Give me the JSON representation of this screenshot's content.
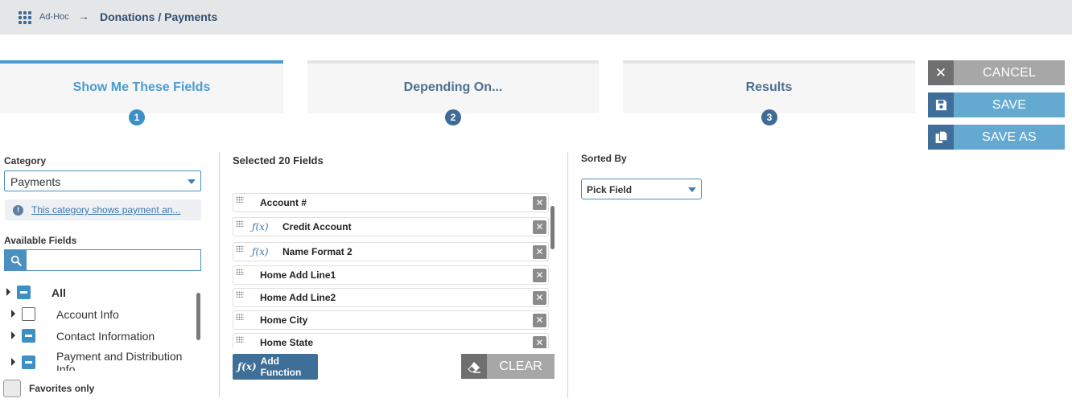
{
  "breadcrumb": {
    "root": "Ad-Hoc",
    "arrow": "→",
    "title": "Donations / Payments"
  },
  "steps": [
    {
      "label": "Show Me These Fields",
      "number": "1",
      "active": true
    },
    {
      "label": "Depending On...",
      "number": "2",
      "active": false
    },
    {
      "label": "Results",
      "number": "3",
      "active": false
    }
  ],
  "actions": {
    "cancel": "CANCEL",
    "save": "SAVE",
    "save_as": "SAVE AS"
  },
  "left": {
    "category_label": "Category",
    "category_value": "Payments",
    "info_text": "This category shows payment an...",
    "available_label": "Available Fields",
    "search_placeholder": "",
    "tree": [
      {
        "label": "All",
        "state": "partial"
      },
      {
        "label": "Account Info",
        "state": "empty"
      },
      {
        "label": "Contact Information",
        "state": "partial"
      },
      {
        "label": "Payment and Distribution Info",
        "state": "partial"
      }
    ],
    "favorites_label": "Favorites only"
  },
  "middle": {
    "selected_label": "Selected 20 Fields",
    "fields": [
      {
        "name": "Account #",
        "fx": false
      },
      {
        "name": "Credit Account",
        "fx": true
      },
      {
        "name": "Name Format 2",
        "fx": true
      },
      {
        "name": "Home Add Line1",
        "fx": false
      },
      {
        "name": "Home Add Line2",
        "fx": false
      },
      {
        "name": "Home City",
        "fx": false
      },
      {
        "name": "Home State",
        "fx": false
      }
    ],
    "fx_symbol": "ƒ(x)",
    "add_function": "Add Function",
    "clear": "CLEAR"
  },
  "right": {
    "sorted_label": "Sorted By",
    "sort_value": "Pick Field"
  },
  "colors": {
    "accent": "#4b9bd0",
    "dark_blue": "#3f6e99",
    "light_blue": "#63a9d0",
    "gray": "#a7a7a7"
  }
}
